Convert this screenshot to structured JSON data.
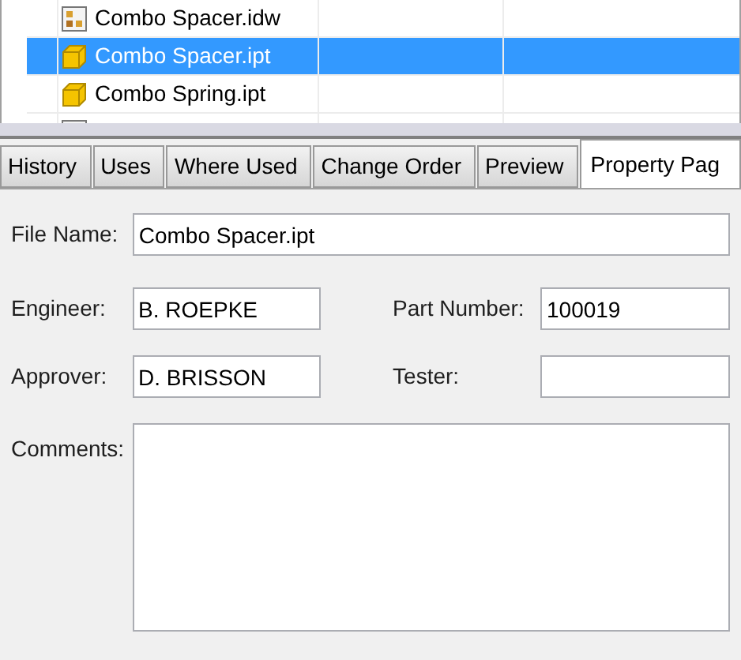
{
  "file_list": {
    "rows": [
      {
        "kind": "drawing",
        "name": "Combo Spacer.idw",
        "selected": false
      },
      {
        "kind": "part",
        "name": "Combo Spacer.ipt",
        "selected": true
      },
      {
        "kind": "part",
        "name": "Combo Spring.ipt",
        "selected": false
      },
      {
        "kind": "drawing",
        "selected": false
      }
    ]
  },
  "tabs": [
    {
      "label": "History",
      "selected": false
    },
    {
      "label": "Uses",
      "selected": false
    },
    {
      "label": "Where Used",
      "selected": false
    },
    {
      "label": "Change Order",
      "selected": false
    },
    {
      "label": "Preview",
      "selected": false
    },
    {
      "label": "Property Pag",
      "selected": true
    }
  ],
  "form": {
    "file_name": {
      "label": "File Name:",
      "value": "Combo Spacer.ipt"
    },
    "engineer": {
      "label": "Engineer:",
      "value": "B. ROEPKE"
    },
    "part_number": {
      "label": "Part Number:",
      "value": "100019"
    },
    "approver": {
      "label": "Approver:",
      "value": "D. BRISSON"
    },
    "tester": {
      "label": "Tester:"
    },
    "comments": {
      "label": "Comments:"
    }
  }
}
